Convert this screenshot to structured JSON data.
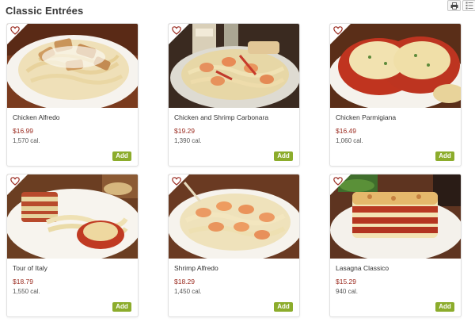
{
  "section": {
    "title": "Classic Entrées"
  },
  "toolbar": {
    "print_icon": "print-icon",
    "list_icon": "list-view-icon"
  },
  "colors": {
    "price": "#9a2a1f",
    "add_button": "#8cac2c",
    "heart": "#9a2a1f"
  },
  "items": [
    {
      "name": "Chicken Alfredo",
      "price": "$16.99",
      "calories": "1,570 cal.",
      "add_label": "Add"
    },
    {
      "name": "Chicken and Shrimp Carbonara",
      "price": "$19.29",
      "calories": "1,390 cal.",
      "add_label": "Add"
    },
    {
      "name": "Chicken Parmigiana",
      "price": "$16.49",
      "calories": "1,060 cal.",
      "add_label": "Add"
    },
    {
      "name": "Tour of Italy",
      "price": "$18.79",
      "calories": "1,550 cal.",
      "add_label": "Add"
    },
    {
      "name": "Shrimp Alfredo",
      "price": "$18.29",
      "calories": "1,450 cal.",
      "add_label": "Add"
    },
    {
      "name": "Lasagna Classico",
      "price": "$15.29",
      "calories": "940 cal.",
      "add_label": "Add"
    }
  ]
}
